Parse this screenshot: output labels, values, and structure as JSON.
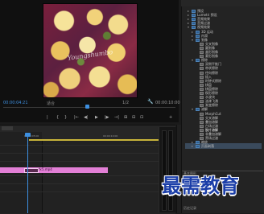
{
  "monitor": {
    "watermark_text": "Youngshumbo",
    "timecode_left": "00:00:04:21",
    "fit_label": "适合",
    "ratio": "1/2",
    "timecode_right": "00:00:10:00",
    "controls": [
      "|",
      "{",
      "}",
      "|←",
      "◀|",
      "▶",
      "|▶",
      "→|",
      "⊞",
      "⊟",
      "⊡",
      "+"
    ]
  },
  "timeline": {
    "ticks": [
      "00:00:05:00",
      "00:00:10:00"
    ],
    "clip_name": "交叉溶解",
    "clip_fx": "fx",
    "clip_suffix": "5.mp4"
  },
  "effects": {
    "tree": [
      {
        "label": "预设",
        "indent": 1,
        "icon": "folder-icon",
        "caret": "▸"
      },
      {
        "label": "Lumetri 预设",
        "indent": 1,
        "icon": "folder-icon",
        "caret": "▸"
      },
      {
        "label": "音频效果",
        "indent": 1,
        "icon": "folder-icon",
        "caret": "▸"
      },
      {
        "label": "音频过渡",
        "indent": 1,
        "icon": "folder-icon",
        "caret": "▸"
      },
      {
        "label": "视频效果",
        "indent": 1,
        "icon": "folder-icon",
        "caret": "▾"
      },
      {
        "label": "3D 运动",
        "indent": 2,
        "icon": "folder-icon",
        "caret": "▸"
      },
      {
        "label": "内滑",
        "indent": 2,
        "icon": "folder-icon",
        "caret": "▸"
      },
      {
        "label": "划像",
        "indent": 2,
        "icon": "folder-icon",
        "caret": "▾"
      },
      {
        "label": "交叉划像",
        "indent": 3,
        "icon": "effect-icon",
        "caret": ""
      },
      {
        "label": "圆划像",
        "indent": 3,
        "icon": "effect-icon",
        "caret": ""
      },
      {
        "label": "盒形划像",
        "indent": 3,
        "icon": "effect-icon",
        "caret": ""
      },
      {
        "label": "菱形划像",
        "indent": 3,
        "icon": "effect-icon",
        "caret": ""
      },
      {
        "label": "擦除",
        "indent": 2,
        "icon": "folder-icon",
        "caret": "▾"
      },
      {
        "label": "双侧平推门",
        "indent": 3,
        "icon": "effect-icon",
        "caret": ""
      },
      {
        "label": "带状擦除",
        "indent": 3,
        "icon": "effect-icon",
        "caret": ""
      },
      {
        "label": "径向擦除",
        "indent": 3,
        "icon": "effect-icon",
        "caret": ""
      },
      {
        "label": "插入",
        "indent": 3,
        "icon": "effect-icon",
        "caret": ""
      },
      {
        "label": "时钟式擦除",
        "indent": 3,
        "icon": "effect-icon",
        "caret": ""
      },
      {
        "label": "棋盘",
        "indent": 3,
        "icon": "effect-icon",
        "caret": ""
      },
      {
        "label": "棋盘擦除",
        "indent": 3,
        "icon": "effect-icon",
        "caret": ""
      },
      {
        "label": "楔形擦除",
        "indent": 3,
        "icon": "effect-icon",
        "caret": ""
      },
      {
        "label": "水波块",
        "indent": 3,
        "icon": "effect-icon",
        "caret": ""
      },
      {
        "label": "油漆飞溅",
        "indent": 3,
        "icon": "effect-icon",
        "caret": ""
      },
      {
        "label": "渐变擦除",
        "indent": 3,
        "icon": "effect-icon",
        "caret": ""
      },
      {
        "label": "溶解",
        "indent": 2,
        "icon": "folder-icon",
        "caret": "▾"
      },
      {
        "label": "MorphCut",
        "indent": 3,
        "icon": "effect-icon",
        "caret": ""
      },
      {
        "label": "交叉溶解",
        "indent": 3,
        "icon": "effect-icon",
        "caret": ""
      },
      {
        "label": "叠加溶解",
        "indent": 3,
        "icon": "effect-icon",
        "caret": ""
      },
      {
        "label": "白场过渡",
        "indent": 3,
        "icon": "effect-icon",
        "caret": ""
      },
      {
        "label": "胶片溶解",
        "indent": 3,
        "icon": "effect-icon",
        "caret": ""
      },
      {
        "label": "非叠加溶解",
        "indent": 3,
        "icon": "effect-icon",
        "caret": ""
      },
      {
        "label": "黑场过渡",
        "indent": 3,
        "icon": "effect-icon",
        "caret": ""
      },
      {
        "label": "缩放",
        "indent": 2,
        "icon": "folder-icon",
        "caret": "▸"
      },
      {
        "label": "页面剥落",
        "indent": 2,
        "icon": "folder-icon",
        "caret": "▸"
      }
    ],
    "selected_index": 29,
    "lower_title_1": "基本图形",
    "lower_item_1": "浏览",
    "lower_item_2": "编辑",
    "lower_title_2": "历史记录"
  },
  "brand": {
    "text": "最需教育",
    "color": "#1b3ea8"
  },
  "colors": {
    "accent": "#3d8fe0",
    "clip": "#e27fd6",
    "work_area": "#c8b43a"
  }
}
